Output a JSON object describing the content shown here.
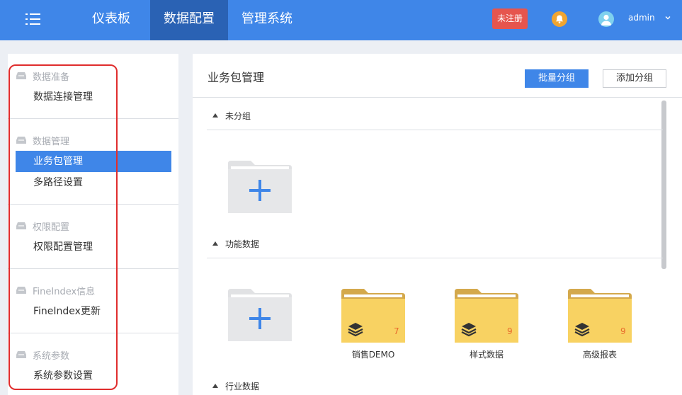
{
  "colors": {
    "accent": "#3f86e8",
    "accent_dark": "#2a62b4",
    "danger": "#e6554e",
    "folder": "#f8d262",
    "count": "#e86a2c"
  },
  "topbar": {
    "tabs": [
      {
        "label": "仪表板"
      },
      {
        "label": "数据配置"
      },
      {
        "label": "管理系统"
      }
    ],
    "active_tab": "数据配置",
    "unregistered_label": "未注册",
    "bell_icon": "bell-icon",
    "avatar_icon": "user-avatar-icon",
    "username": "admin"
  },
  "sidebar": {
    "groups": [
      {
        "title": "数据准备",
        "items": [
          {
            "label": "数据连接管理"
          }
        ]
      },
      {
        "title": "数据管理",
        "items": [
          {
            "label": "业务包管理"
          },
          {
            "label": "多路径设置"
          }
        ]
      },
      {
        "title": "权限配置",
        "items": [
          {
            "label": "权限配置管理"
          }
        ]
      },
      {
        "title": "FineIndex信息",
        "items": [
          {
            "label": "FineIndex更新"
          }
        ]
      },
      {
        "title": "系统参数",
        "items": [
          {
            "label": "系统参数设置"
          }
        ]
      }
    ],
    "active_item": "业务包管理"
  },
  "main": {
    "title": "业务包管理",
    "batch_group_label": "批量分组",
    "add_group_label": "添加分组",
    "sections": [
      {
        "name": "未分组",
        "packages": []
      },
      {
        "name": "功能数据",
        "packages": [
          {
            "name": "销售DEMO",
            "count": "7"
          },
          {
            "name": "样式数据",
            "count": "9"
          },
          {
            "name": "高级报表",
            "count": "9"
          }
        ]
      },
      {
        "name": "行业数据",
        "packages": []
      }
    ]
  }
}
